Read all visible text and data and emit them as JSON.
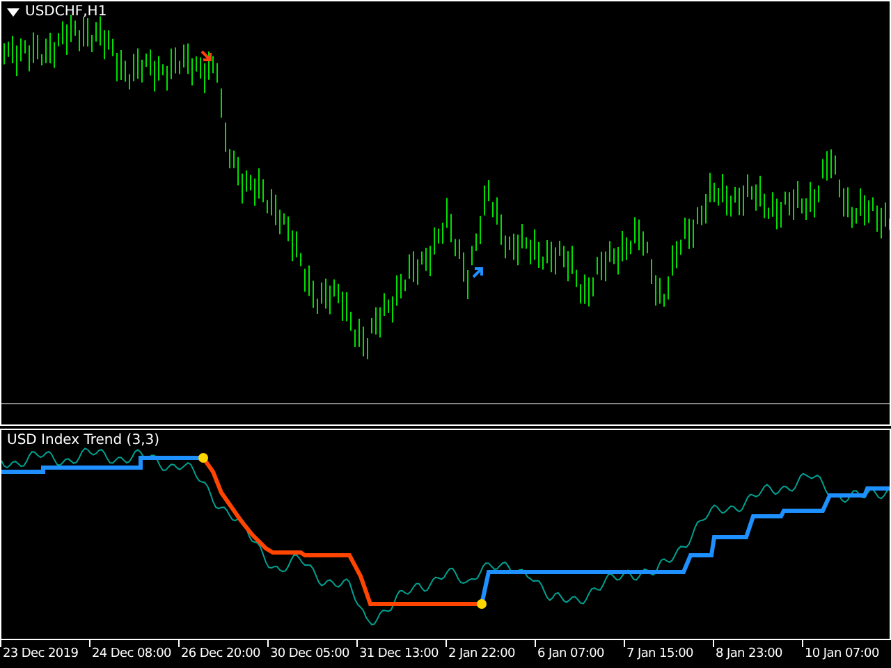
{
  "main_chart": {
    "title": "USDCHF,H1"
  },
  "indicator": {
    "title": "USD Index Trend (3,3)"
  },
  "time_axis": {
    "labels": [
      "23 Dec 2019",
      "24 Dec 08:00",
      "26 Dec 20:00",
      "30 Dec 05:00",
      "31 Dec 13:00",
      "2 Jan 22:00",
      "6 Jan 07:00",
      "7 Jan 15:00",
      "8 Jan 23:00",
      "10 Jan 07:00"
    ]
  }
}
